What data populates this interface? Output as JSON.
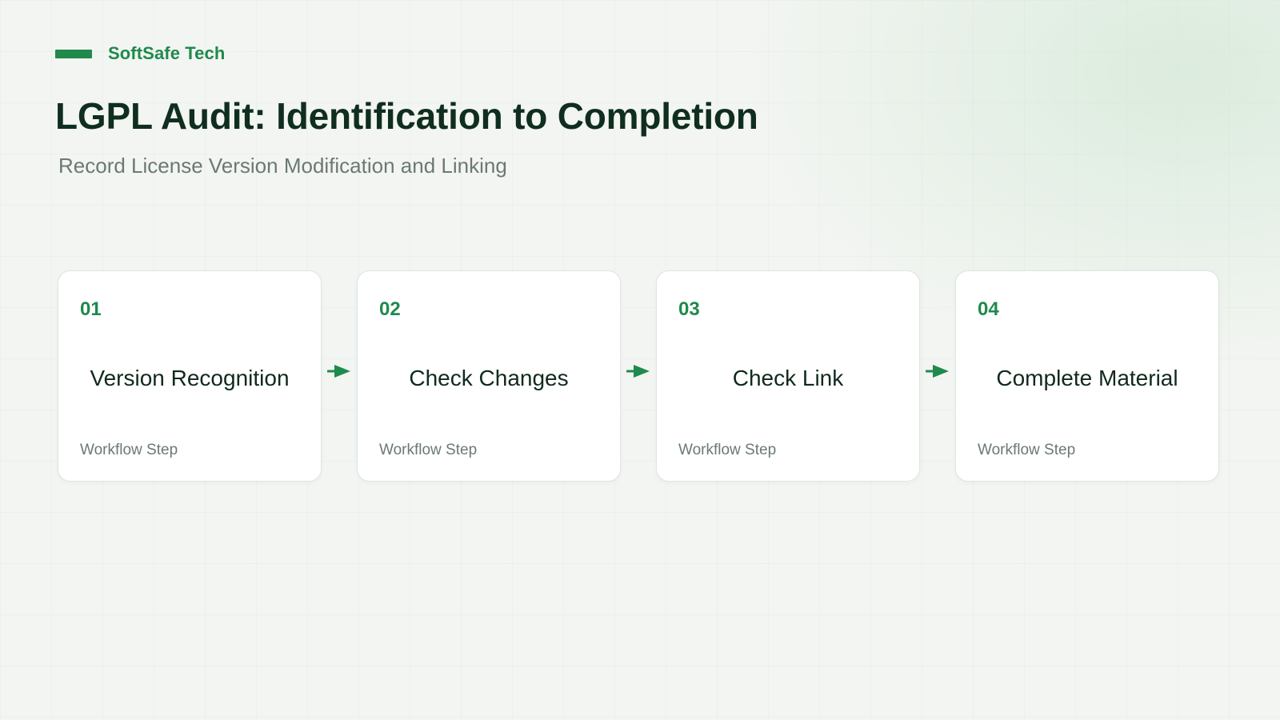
{
  "brand": {
    "name": "SoftSafe Tech",
    "accent_color": "#1f8a4c"
  },
  "title": "LGPL Audit: Identification to Completion",
  "subtitle": "Record License Version Modification and Linking",
  "steps": [
    {
      "number": "01",
      "title": "Version Recognition",
      "caption": "Workflow Step"
    },
    {
      "number": "02",
      "title": "Check Changes",
      "caption": "Workflow Step"
    },
    {
      "number": "03",
      "title": "Check Link",
      "caption": "Workflow Step"
    },
    {
      "number": "04",
      "title": "Complete Material",
      "caption": "Workflow Step"
    }
  ],
  "connector_icon": "arrow-right-icon"
}
